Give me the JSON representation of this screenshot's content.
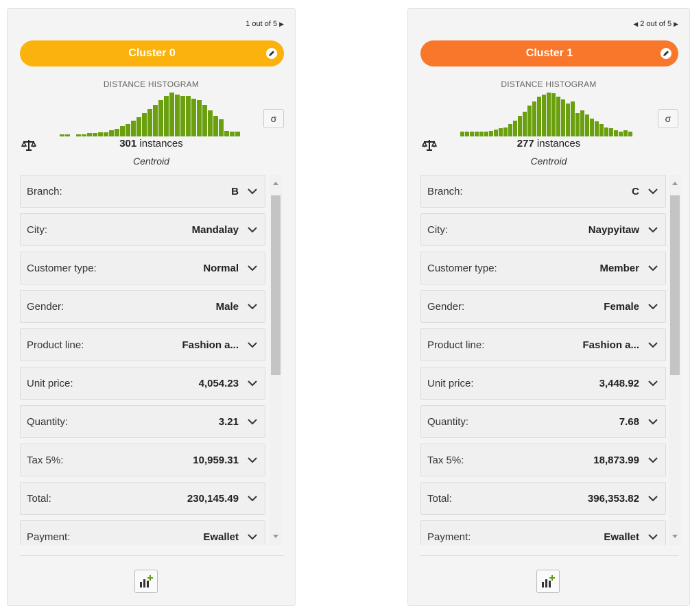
{
  "accent_colors": {
    "cluster_0": "#fbb20c",
    "cluster_1": "#f8772b",
    "histogram_bar": "#6aa00f"
  },
  "panels": [
    {
      "pager_text": "1 out of 5",
      "show_prev": false,
      "cluster_name": "Cluster 0",
      "histogram_title": "DISTANCE HISTOGRAM",
      "histogram_values": [
        0.05,
        0.05,
        0,
        0.05,
        0.05,
        0.07,
        0.07,
        0.09,
        0.09,
        0.13,
        0.17,
        0.22,
        0.28,
        0.35,
        0.42,
        0.52,
        0.6,
        0.7,
        0.8,
        0.9,
        0.97,
        0.92,
        0.9,
        0.9,
        0.83,
        0.8,
        0.7,
        0.58,
        0.45,
        0.38,
        0.12,
        0.1,
        0.1
      ],
      "sigma_label": "σ",
      "instances_count": "301",
      "instances_label": "instances",
      "centroid_label": "Centroid",
      "fields": [
        {
          "label": "Branch:",
          "value": "B"
        },
        {
          "label": "City:",
          "value": "Mandalay"
        },
        {
          "label": "Customer type:",
          "value": "Normal"
        },
        {
          "label": "Gender:",
          "value": "Male"
        },
        {
          "label": "Product line:",
          "value": "Fashion a..."
        },
        {
          "label": "Unit price:",
          "value": "4,054.23"
        },
        {
          "label": "Quantity:",
          "value": "3.21"
        },
        {
          "label": "Tax 5%:",
          "value": "10,959.31"
        },
        {
          "label": "Total:",
          "value": "230,145.49"
        },
        {
          "label": "Payment:",
          "value": "Ewallet"
        }
      ]
    },
    {
      "pager_text": "2 out of 5",
      "show_prev": true,
      "cluster_name": "Cluster 1",
      "histogram_title": "DISTANCE HISTOGRAM",
      "histogram_values": [
        0.1,
        0.1,
        0.1,
        0.1,
        0.1,
        0.1,
        0.12,
        0.15,
        0.18,
        0.2,
        0.28,
        0.35,
        0.45,
        0.55,
        0.68,
        0.78,
        0.88,
        0.93,
        0.97,
        0.95,
        0.88,
        0.82,
        0.72,
        0.78,
        0.52,
        0.58,
        0.48,
        0.4,
        0.33,
        0.28,
        0.2,
        0.18,
        0.13,
        0.1,
        0.13,
        0.1
      ],
      "sigma_label": "σ",
      "instances_count": "277",
      "instances_label": "instances",
      "centroid_label": "Centroid",
      "fields": [
        {
          "label": "Branch:",
          "value": "C"
        },
        {
          "label": "City:",
          "value": "Naypyitaw"
        },
        {
          "label": "Customer type:",
          "value": "Member"
        },
        {
          "label": "Gender:",
          "value": "Female"
        },
        {
          "label": "Product line:",
          "value": "Fashion a..."
        },
        {
          "label": "Unit price:",
          "value": "3,448.92"
        },
        {
          "label": "Quantity:",
          "value": "7.68"
        },
        {
          "label": "Tax 5%:",
          "value": "18,873.99"
        },
        {
          "label": "Total:",
          "value": "396,353.82"
        },
        {
          "label": "Payment:",
          "value": "Ewallet"
        }
      ]
    }
  ]
}
